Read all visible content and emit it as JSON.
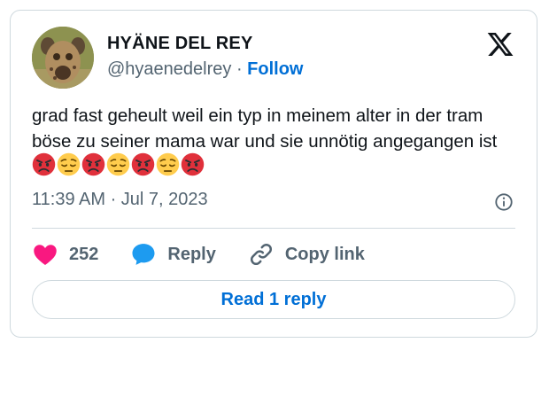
{
  "author": {
    "display_name": "HYÄNE DEL REY",
    "handle": "@hyaenedelrey",
    "separator": " · ",
    "follow_label": "Follow"
  },
  "tweet": {
    "text": "grad fast geheult weil ein typ in meinem alter in der tram böse zu seiner mama war und sie unnötig angegangen ist",
    "emojis": [
      "angry-face",
      "pensive-face",
      "angry-face",
      "pensive-face",
      "angry-face",
      "pensive-face",
      "angry-face"
    ],
    "timestamp": "11:39 AM · Jul 7, 2023"
  },
  "actions": {
    "like_count": "252",
    "reply_label": "Reply",
    "copy_link_label": "Copy link"
  },
  "read_replies_label": "Read 1 reply",
  "colors": {
    "like": "#f91880",
    "reply": "#1d9bf0",
    "link": "#006fd6",
    "secondary_text": "#536471",
    "angry_emoji": "#e0303b",
    "pensive_emoji": "#ffcc4d"
  }
}
